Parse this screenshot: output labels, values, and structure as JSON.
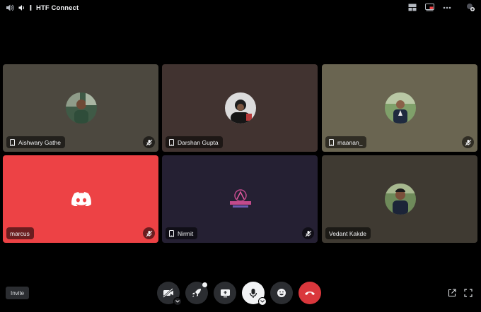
{
  "window": {
    "title": "HTF Connect"
  },
  "tiles": [
    {
      "name": "Aishwary Gathe",
      "bg": "#4c483f",
      "muted": true,
      "device": "mobile"
    },
    {
      "name": "Darshan Gupta",
      "bg": "#413330",
      "muted": false,
      "device": "mobile"
    },
    {
      "name": "maanan_",
      "bg": "#6a6551",
      "muted": true,
      "device": "mobile"
    },
    {
      "name": "marcus",
      "bg": "#ed4245",
      "muted": true,
      "device": "none"
    },
    {
      "name": "Nirmit",
      "bg": "#252033",
      "muted": true,
      "device": "mobile"
    },
    {
      "name": "Vedant Kakde",
      "bg": "#3f3a32",
      "muted": false,
      "device": "none"
    }
  ],
  "footer": {
    "invite_label": "Invite"
  },
  "colors": {
    "accent_red": "#da373c",
    "discord_red": "#ed4245",
    "surface": "#2b2d31"
  }
}
